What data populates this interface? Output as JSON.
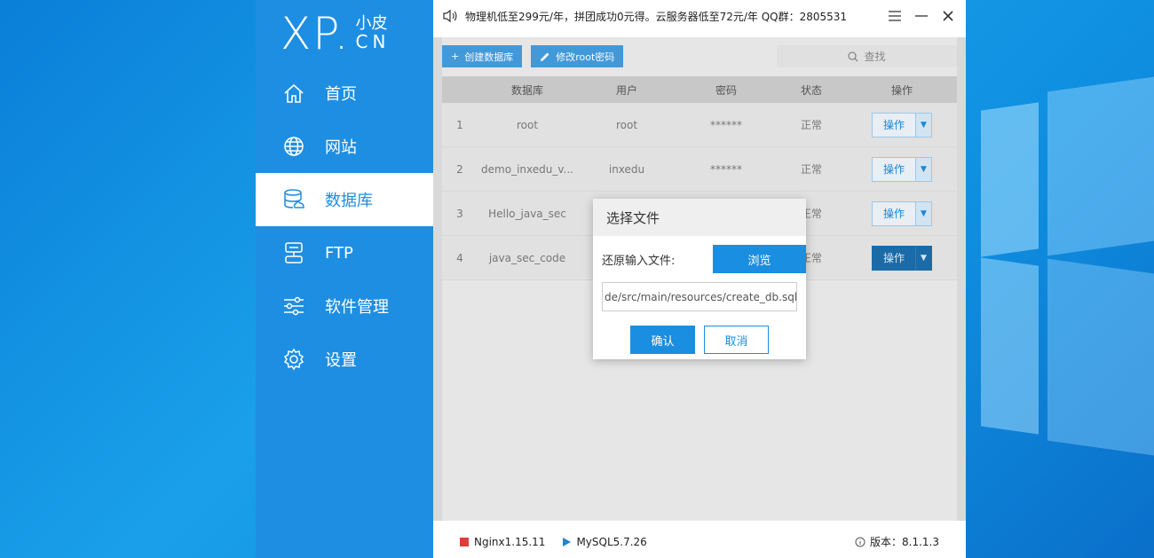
{
  "logo": {
    "main": "XP.",
    "top": "小皮",
    "bottom": "CN"
  },
  "sidebar": {
    "items": [
      {
        "label": "首页",
        "icon": "home-icon"
      },
      {
        "label": "网站",
        "icon": "globe-icon"
      },
      {
        "label": "数据库",
        "icon": "database-icon",
        "active": true
      },
      {
        "label": "FTP",
        "icon": "ftp-icon"
      },
      {
        "label": "软件管理",
        "icon": "sliders-icon"
      },
      {
        "label": "设置",
        "icon": "gear-icon"
      }
    ]
  },
  "topbar": {
    "message": "物理机低至299元/年，拼团成功0元得。云服务器低至72元/年 QQ群：2805531"
  },
  "toolbar": {
    "create_db": "创建数据库",
    "change_root_pw": "修改root密码",
    "search_placeholder": "查找"
  },
  "table": {
    "headers": [
      "数据库",
      "用户",
      "密码",
      "状态",
      "操作"
    ],
    "rows": [
      {
        "num": "1",
        "db": "root",
        "user": "root",
        "password": "******",
        "status": "正常",
        "action": "操作"
      },
      {
        "num": "2",
        "db": "demo_inxedu_v...",
        "user": "inxedu",
        "password": "******",
        "status": "正常",
        "action": "操作"
      },
      {
        "num": "3",
        "db": "Hello_java_sec",
        "user": "",
        "password": "",
        "status": "正常",
        "action": "操作"
      },
      {
        "num": "4",
        "db": "java_sec_code",
        "user": "",
        "password": "",
        "status": "正常",
        "action": "操作"
      }
    ]
  },
  "dialog": {
    "title": "选择文件",
    "restore_label": "还原输入文件:",
    "browse": "浏览",
    "path": "de/src/main/resources/create_db.sql",
    "confirm": "确认",
    "cancel": "取消"
  },
  "statusbar": {
    "nginx": "Nginx1.15.11",
    "mysql": "MySQL5.7.26",
    "version": "版本：8.1.1.3"
  },
  "colors": {
    "sidebar": "#1e8ee2",
    "accent": "#1a8ee0",
    "nginx_status": "#e23a3a"
  }
}
